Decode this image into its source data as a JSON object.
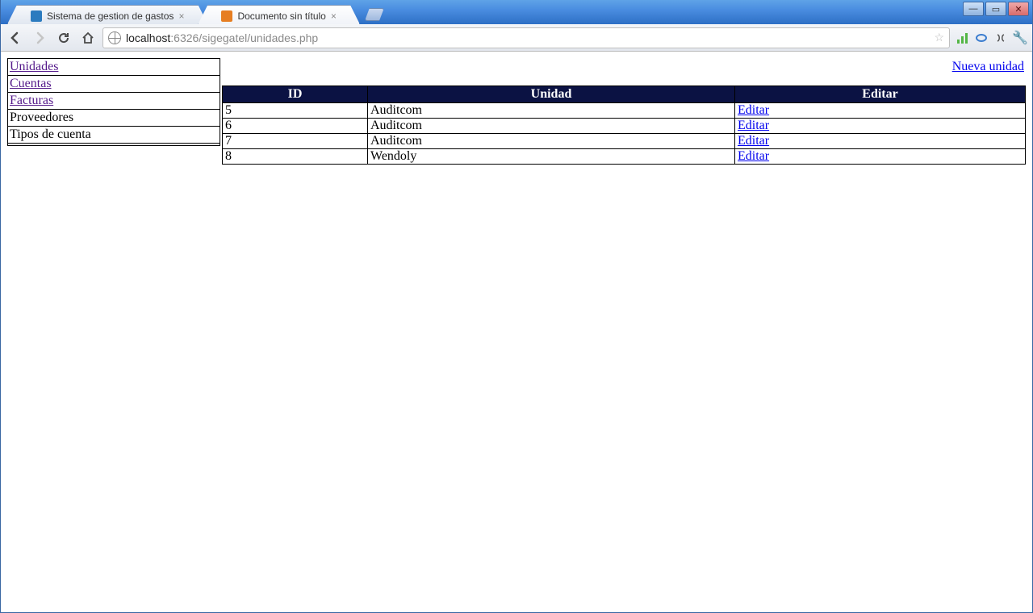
{
  "browser": {
    "tabs": [
      {
        "title": "Sistema de gestion de gastos",
        "active": false
      },
      {
        "title": "Documento sin título",
        "active": true
      }
    ],
    "url_host": "localhost",
    "url_port_path": ":6326/sigegatel/unidades.php"
  },
  "sidebar": {
    "items": [
      {
        "label": "Unidades",
        "link": true
      },
      {
        "label": "Cuentas",
        "link": true
      },
      {
        "label": "Facturas",
        "link": true
      },
      {
        "label": "Proveedores",
        "link": false
      },
      {
        "label": "Tipos de cuenta",
        "link": false
      },
      {
        "label": "",
        "link": false
      }
    ]
  },
  "actions": {
    "new_unit": "Nueva unidad"
  },
  "table": {
    "headers": {
      "id": "ID",
      "unidad": "Unidad",
      "editar": "Editar"
    },
    "edit_label": "Editar",
    "rows": [
      {
        "id": "5",
        "unidad": "Auditcom"
      },
      {
        "id": "6",
        "unidad": "Auditcom"
      },
      {
        "id": "7",
        "unidad": "Auditcom"
      },
      {
        "id": "8",
        "unidad": "Wendoly"
      }
    ]
  }
}
